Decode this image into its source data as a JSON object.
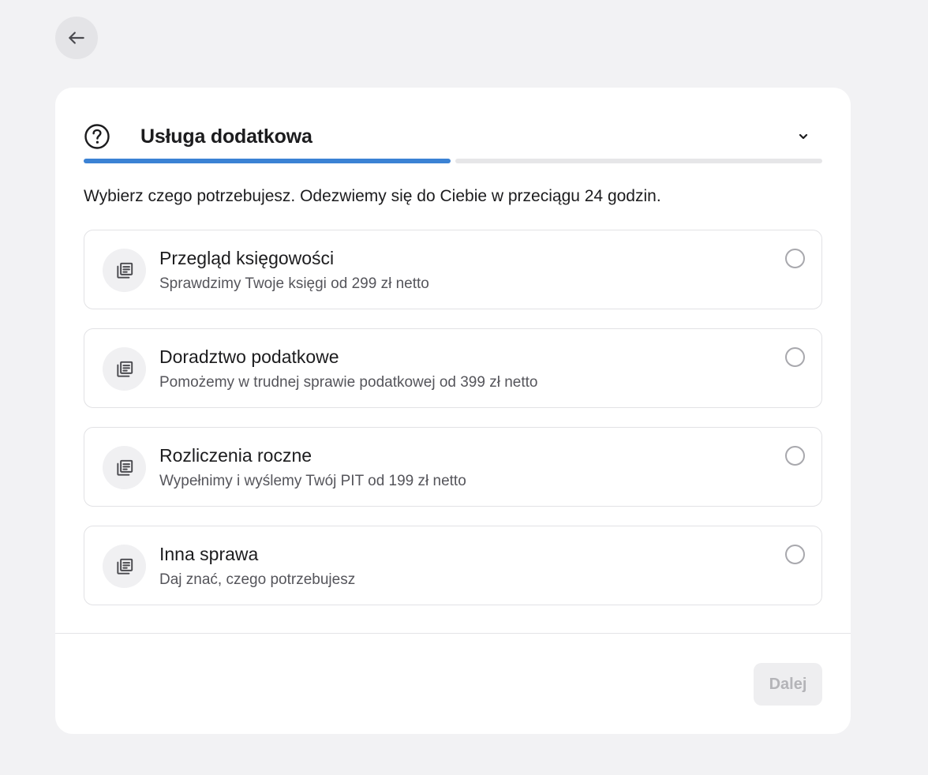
{
  "nav": {
    "back_icon": "arrow-left-icon"
  },
  "header": {
    "icon": "question-circle-icon",
    "title": "Usługa dodatkowa",
    "collapse_icon": "chevron-down-icon"
  },
  "progress": {
    "step": 1,
    "total_steps": 2,
    "active_color": "#3b82d4"
  },
  "subtitle": "Wybierz czego potrzebujesz. Odezwiemy się do Ciebie w przeciągu 24 godzin.",
  "options": [
    {
      "icon": "document-stack-icon",
      "title": "Przegląd księgowości",
      "description": "Sprawdzimy Twoje księgi od 299 zł netto",
      "selected": false
    },
    {
      "icon": "document-stack-icon",
      "title": "Doradztwo podatkowe",
      "description": "Pomożemy w trudnej sprawie podatkowej od 399 zł netto",
      "selected": false
    },
    {
      "icon": "document-stack-icon",
      "title": "Rozliczenia roczne",
      "description": "Wypełnimy i wyślemy Twój PIT od 199 zł netto",
      "selected": false
    },
    {
      "icon": "document-stack-icon",
      "title": "Inna sprawa",
      "description": "Daj znać, czego potrzebujesz",
      "selected": false
    }
  ],
  "footer": {
    "next_label": "Dalej",
    "next_disabled": true
  }
}
